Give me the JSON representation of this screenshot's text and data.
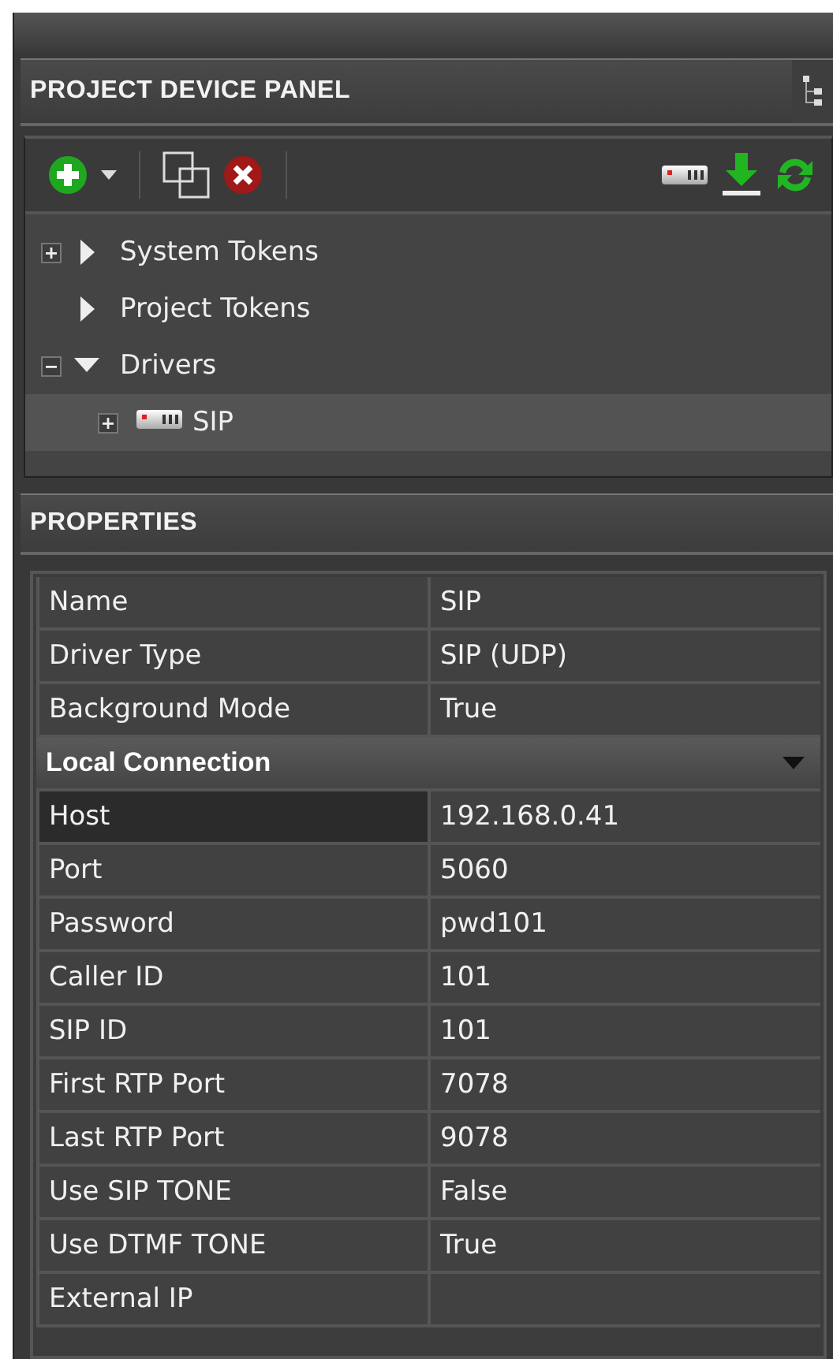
{
  "device_panel": {
    "title": "PROJECT DEVICE PANEL",
    "tree": [
      {
        "label": "System Tokens",
        "expandable": true,
        "expanded": false,
        "kind": "folder",
        "selected": false
      },
      {
        "label": "Project Tokens",
        "expandable": false,
        "expanded": false,
        "kind": "folder",
        "selected": false
      },
      {
        "label": "Drivers",
        "expandable": true,
        "expanded": true,
        "kind": "folder",
        "selected": false,
        "children": [
          {
            "label": "SIP",
            "expandable": true,
            "expanded": false,
            "kind": "device",
            "selected": true
          }
        ]
      }
    ]
  },
  "properties": {
    "title": "PROPERTIES",
    "rows": [
      {
        "kind": "property",
        "name": "Name",
        "value": "SIP",
        "selected": false
      },
      {
        "kind": "property",
        "name": "Driver Type",
        "value": "SIP (UDP)",
        "selected": false
      },
      {
        "kind": "property",
        "name": "Background Mode",
        "value": "True",
        "selected": false
      },
      {
        "kind": "category",
        "name": "Local Connection",
        "expanded": true
      },
      {
        "kind": "property",
        "name": "Host",
        "value": "192.168.0.41",
        "selected": true
      },
      {
        "kind": "property",
        "name": "Port",
        "value": "5060",
        "selected": false
      },
      {
        "kind": "property",
        "name": "Password",
        "value": "pwd101",
        "selected": false
      },
      {
        "kind": "property",
        "name": "Caller ID",
        "value": "101",
        "selected": false
      },
      {
        "kind": "property",
        "name": "SIP ID",
        "value": "101",
        "selected": false
      },
      {
        "kind": "property",
        "name": "First RTP Port",
        "value": "7078",
        "selected": false
      },
      {
        "kind": "property",
        "name": "Last RTP Port",
        "value": "9078",
        "selected": false
      },
      {
        "kind": "property",
        "name": "Use SIP TONE",
        "value": "False",
        "selected": false
      },
      {
        "kind": "property",
        "name": "Use DTMF TONE",
        "value": "True",
        "selected": false
      },
      {
        "kind": "property",
        "name": "External IP",
        "value": "",
        "selected": false
      }
    ]
  }
}
